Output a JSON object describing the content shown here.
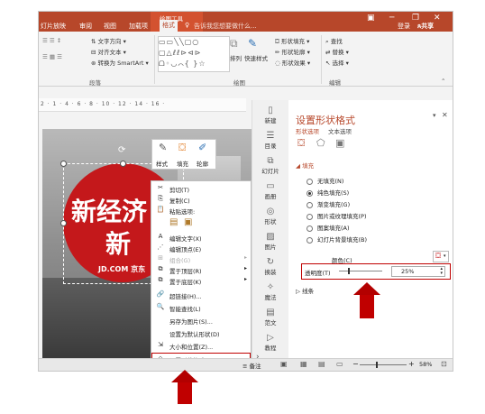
{
  "titlebar": {
    "context_tool": "绘图工具",
    "tabs": [
      "灯片放映",
      "审阅",
      "视图",
      "加载项",
      "格式"
    ],
    "active_tab": "格式",
    "tell_me": "告诉我您想要做什么...",
    "login": "登录",
    "share": "共享"
  },
  "ribbon": {
    "text_direction": "文字方向",
    "align_text": "对齐文本",
    "convert_smartart": "转换为 SmartArt",
    "arrange": "排列",
    "quick_styles": "快速样式",
    "shape_fill": "形状填充",
    "shape_outline": "形状轮廓",
    "shape_effect": "形状效果",
    "find": "查找",
    "replace": "替换",
    "select": "选择",
    "group_paragraph": "段落",
    "group_drawing": "绘图",
    "group_editing": "编辑"
  },
  "ruler": {
    "marks": "2 · 1 · 4 · 6 · 8 · 10 · 12 · 14 · 16 ·"
  },
  "slide": {
    "calli_1": "新经济",
    "calli_2": "新",
    "brand": "JD.COM 京东"
  },
  "mini_toolbar": {
    "style": "样式",
    "fill": "填充",
    "outline": "轮廓"
  },
  "context_menu": {
    "items": [
      {
        "label": "剪切(T)",
        "icon": "✂"
      },
      {
        "label": "复制(C)",
        "icon": "⎘"
      },
      {
        "label": "粘贴选项:",
        "icon": "📋"
      },
      {
        "label": "",
        "icon": ""
      },
      {
        "label": "编辑文字(X)",
        "icon": "A"
      },
      {
        "label": "编辑顶点(E)",
        "icon": "⋰"
      },
      {
        "label": "组合(G)",
        "icon": "⊞",
        "arrow": "▸"
      },
      {
        "label": "置于顶层(R)",
        "icon": "⧉",
        "arrow": "▸"
      },
      {
        "label": "置于底层(K)",
        "icon": "⧉",
        "arrow": "▸"
      },
      {
        "label": "超链接(H)...",
        "icon": "🔗"
      },
      {
        "label": "智能查找(L)",
        "icon": "🔍"
      },
      {
        "label": "另存为图片(S)...",
        "icon": ""
      },
      {
        "label": "设置为默认形状(D)",
        "icon": ""
      },
      {
        "label": "大小和位置(Z)...",
        "icon": "⇲"
      },
      {
        "label": "设置形状格式(O)...",
        "icon": "⬦"
      }
    ]
  },
  "vertical_nav": [
    "新建",
    "目录",
    "幻灯片",
    "画册",
    "形状",
    "图片",
    "换装",
    "魔法",
    "范文",
    "教程"
  ],
  "format_pane": {
    "title": "设置形状格式",
    "tab_shape": "形状选项",
    "tab_text": "文本选项",
    "section_fill": "填充",
    "fill_options": [
      "无填充(N)",
      "纯色填充(S)",
      "渐变填充(G)",
      "图片或纹理填充(P)",
      "图案填充(A)",
      "幻灯片背景填充(B)"
    ],
    "selected_fill": "纯色填充(S)",
    "color_label": "颜色(C)",
    "transparency_label": "透明度(T)",
    "transparency_value": "25%",
    "section_line": "线条"
  },
  "statusbar": {
    "notes": "备注",
    "zoom": "58%"
  },
  "colors": {
    "accent": "#b7472a",
    "highlight_box": "#c00000",
    "arrow": "#b30000"
  }
}
